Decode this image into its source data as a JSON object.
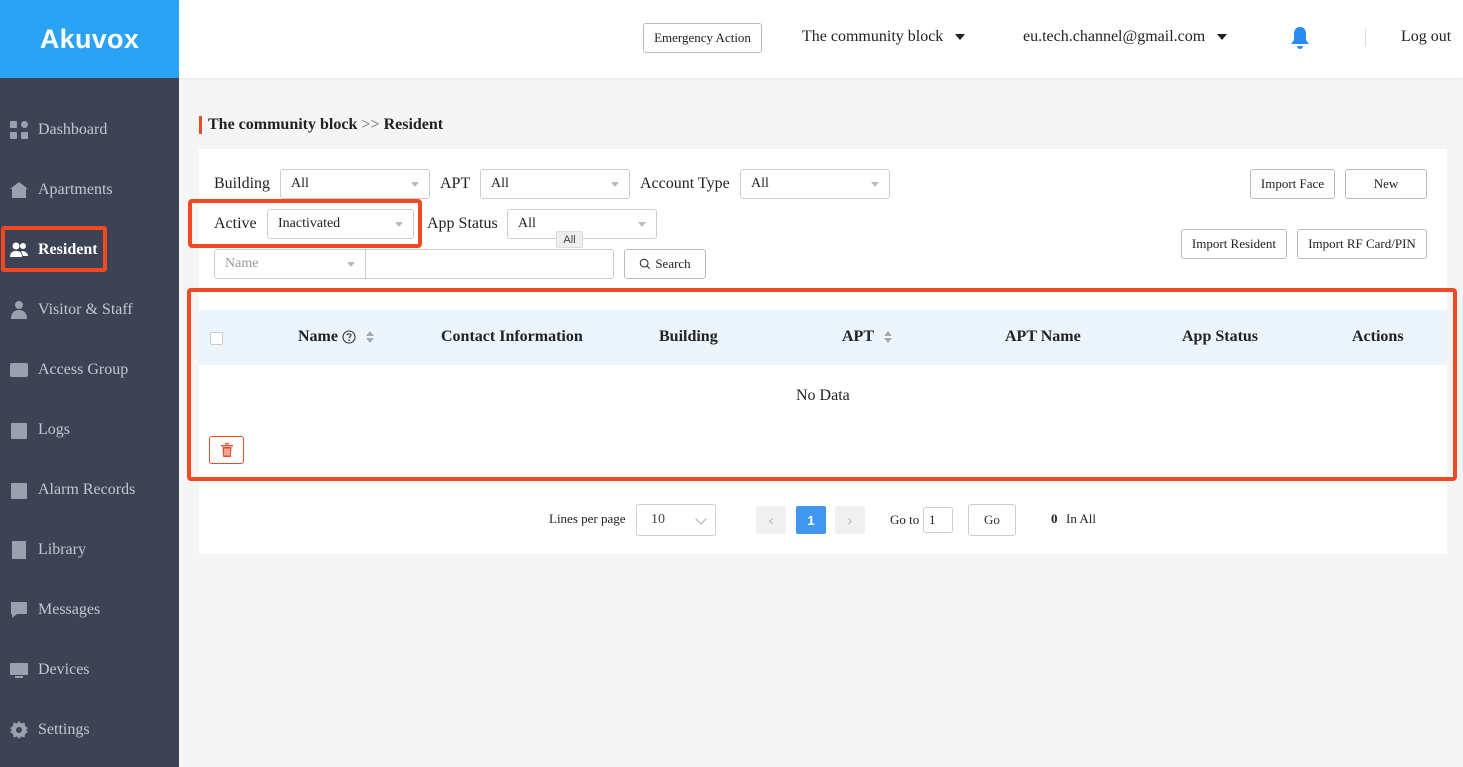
{
  "brand": {
    "logo": "Akuvox",
    "color": "#2aa3f5"
  },
  "header": {
    "emergency_label": "Emergency Action",
    "community": "The community block",
    "account": "eu.tech.channel@gmail.com",
    "logout": "Log out",
    "bell_icon": "bell-icon"
  },
  "sidebar": {
    "items": [
      {
        "label": "Dashboard",
        "icon": "dashboard-icon"
      },
      {
        "label": "Apartments",
        "icon": "apartments-icon"
      },
      {
        "label": "Resident",
        "icon": "resident-icon",
        "active": true
      },
      {
        "label": "Visitor & Staff",
        "icon": "visitor-icon"
      },
      {
        "label": "Access Group",
        "icon": "access-card-icon"
      },
      {
        "label": "Logs",
        "icon": "logs-icon"
      },
      {
        "label": "Alarm Records",
        "icon": "alarm-icon"
      },
      {
        "label": "Library",
        "icon": "library-icon"
      },
      {
        "label": "Messages",
        "icon": "messages-icon"
      },
      {
        "label": "Devices",
        "icon": "devices-icon"
      },
      {
        "label": "Settings",
        "icon": "gear-icon"
      }
    ]
  },
  "breadcrumb": {
    "parent": "The community block",
    "sep": ">>",
    "current": "Resident"
  },
  "filters": {
    "building_label": "Building",
    "building_value": "All",
    "apt_label": "APT",
    "apt_value": "All",
    "account_type_label": "Account Type",
    "account_type_value": "All",
    "active_label": "Active",
    "active_value": "Inactivated",
    "app_status_label": "App Status",
    "app_status_value": "All",
    "tooltip": "All",
    "search_field_placeholder": "Name",
    "search_label": "Search"
  },
  "actions": {
    "import_face": "Import Face",
    "new": "New",
    "import_resident": "Import Resident",
    "import_rf": "Import RF Card/PIN"
  },
  "table": {
    "columns": [
      "Name",
      "Contact Information",
      "Building",
      "APT",
      "APT Name",
      "App Status",
      "Actions"
    ],
    "empty": "No Data"
  },
  "pagination": {
    "lines_label": "Lines per page",
    "lines_value": "10",
    "current_page": "1",
    "goto_label": "Go to",
    "goto_value": "1",
    "go_label": "Go",
    "total": "0",
    "total_label": "In All"
  },
  "colors": {
    "accent": "#ef4a23",
    "primary": "#3f97f0",
    "sidebar": "#3d4254"
  }
}
